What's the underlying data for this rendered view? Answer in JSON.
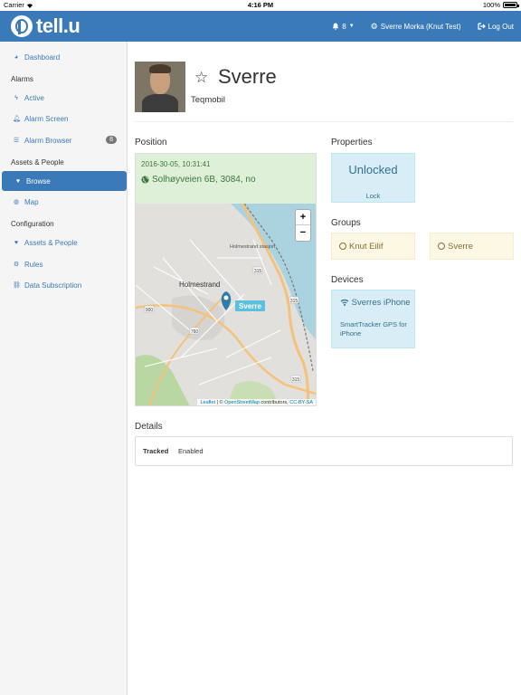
{
  "status_bar": {
    "carrier": "Carrier",
    "time": "4:16 PM",
    "battery": "100%",
    "battery_level": 1.0
  },
  "navbar": {
    "brand": "tell.u",
    "notifications_count": "8",
    "user": "Sverre Morka (Knut Test)",
    "logout": "Log Out",
    "color": "#3b7ab8"
  },
  "sidebar": {
    "dashboard": "Dashboard",
    "alarms_heading": "Alarms",
    "active": "Active",
    "alarm_screen": "Alarm Screen",
    "alarm_browser": "Alarm Browser",
    "alarm_browser_badge": "8",
    "assets_heading": "Assets & People",
    "browse": "Browse",
    "map": "Map",
    "config_heading": "Configuration",
    "assets_people": "Assets & People",
    "rules": "Rules",
    "data_subscription": "Data Subscription"
  },
  "asset": {
    "name": "Sverre",
    "subtitle": "Teqmobil",
    "star_icon": "star-outline-icon"
  },
  "position": {
    "title": "Position",
    "timestamp": "2016-30-05, 10:31:41",
    "address": "Solhøyveien 6B, 3084, no",
    "map": {
      "town": "Holmestrand",
      "station": "Holmestrand stasjon",
      "marker_label": "Sverre",
      "road_labels": [
        "315",
        "315",
        "900",
        "760",
        "315"
      ],
      "zoom_in": "+",
      "zoom_out": "−",
      "attribution_leaflet": "Leaflet",
      "attribution_mid": " | © ",
      "attribution_osm": "OpenStreetMap",
      "attribution_contrib": " contributors, ",
      "attribution_license": "CC-BY-SA"
    }
  },
  "properties": {
    "title": "Properties",
    "state": "Unlocked",
    "label": "Lock"
  },
  "groups": {
    "title": "Groups",
    "items": [
      "Knut Eilif",
      "Sverre"
    ]
  },
  "devices": {
    "title": "Devices",
    "name": "Sverres iPhone",
    "description": "SmartTracker GPS for iPhone"
  },
  "details": {
    "title": "Details",
    "key": "Tracked",
    "value": "Enabled"
  }
}
